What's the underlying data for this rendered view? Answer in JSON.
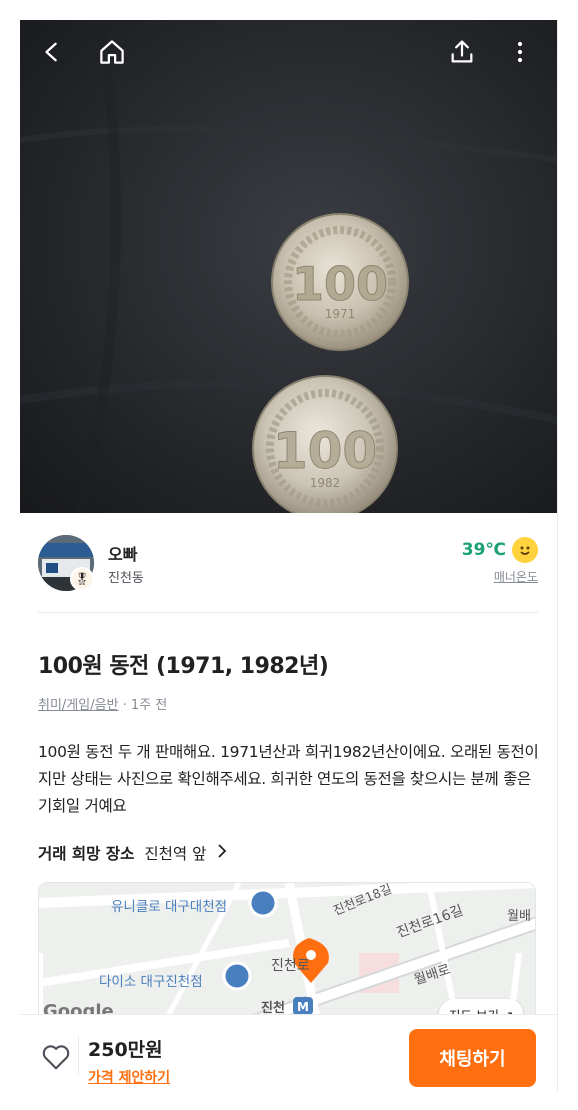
{
  "header": {
    "back_icon": "back-arrow-icon",
    "home_icon": "home-icon",
    "share_icon": "share-icon",
    "more_icon": "more-vertical-icon"
  },
  "photo": {
    "coin_top_value": "100",
    "coin_top_year": "1971",
    "coin_bottom_value": "100",
    "coin_bottom_year": "1982"
  },
  "seller": {
    "name": "오빠",
    "location": "진천동",
    "manner_temp": "39℃",
    "manner_label": "매너온도",
    "temp_color": "#1aa174"
  },
  "product": {
    "title": "100원 동전 (1971, 1982년)",
    "category": "취미/게임/음반",
    "time": " · 1주 전",
    "description": "100원 동전 두 개 판매해요. 1971년산과  희귀1982년산이에요. 오래된 동전이지만 상태는 사진으로 확인해주세요. 희귀한 연도의 동전을 찾으시는 분께 좋은 기회일 거예요"
  },
  "place": {
    "label": "거래 희망 장소",
    "value": "진천역 앞",
    "chevron_icon": "chevron-right-icon"
  },
  "map": {
    "poi_1": "유니클로 대구대천점",
    "poi_2": "다이소 대구진천점",
    "road_1": "진천로18길",
    "road_2": "진천로16길",
    "road_3": "월배",
    "road_4": "월배로",
    "road_5": "진천로",
    "station": "진천",
    "view_map": "지도 보기 ↗",
    "google": "Google"
  },
  "bottom": {
    "price": "250만원",
    "offer": "가격 제안하기",
    "chat_button": "채팅하기",
    "accent": "#ff6f0f"
  }
}
